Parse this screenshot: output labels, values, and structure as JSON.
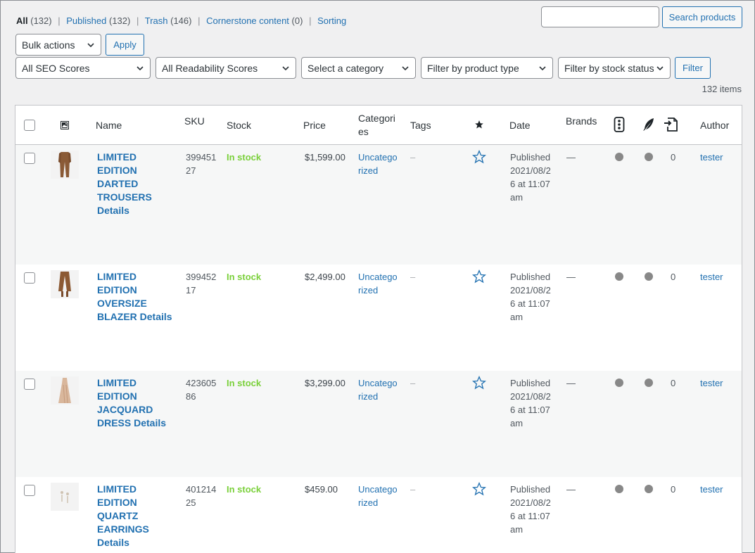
{
  "views": {
    "all": {
      "label": "All",
      "count": "(132)"
    },
    "published": {
      "label": "Published",
      "count": "(132)"
    },
    "trash": {
      "label": "Trash",
      "count": "(146)"
    },
    "cornerstone": {
      "label": "Cornerstone content",
      "count": "(0)"
    },
    "sorting": {
      "label": "Sorting"
    }
  },
  "search": {
    "placeholder": "",
    "button": "Search products"
  },
  "bulk": {
    "label": "Bulk actions",
    "apply": "Apply"
  },
  "filters": {
    "seo": "All SEO Scores",
    "readability": "All Readability Scores",
    "category": "Select a category",
    "product_type": "Filter by product type",
    "stock_status": "Filter by stock status",
    "button": "Filter"
  },
  "items_count": "132 items",
  "columns": {
    "name": "Name",
    "sku": "SKU",
    "stock": "Stock",
    "price": "Price",
    "categories": "Categories",
    "tags": "Tags",
    "date": "Date",
    "brands": "Brands",
    "author": "Author"
  },
  "rows": [
    {
      "name": "LIMITED EDITION DARTED TROUSERS Details",
      "sku": "39945127",
      "stock": "In stock",
      "price": "$1,599.00",
      "category": "Uncategorized",
      "tags": "–",
      "date": "Published 2021/08/26 at 11:07 am",
      "brand": "—",
      "links": "0",
      "author": "tester",
      "thumb_color": "#8a5a36"
    },
    {
      "name": "LIMITED EDITION OVERSIZE BLAZER Details",
      "sku": "39945217",
      "stock": "In stock",
      "price": "$2,499.00",
      "category": "Uncategorized",
      "tags": "–",
      "date": "Published 2021/08/26 at 11:07 am",
      "brand": "—",
      "links": "0",
      "author": "tester",
      "thumb_color": "#8c5a34"
    },
    {
      "name": "LIMITED EDITION JACQUARD DRESS Details",
      "sku": "42360586",
      "stock": "In stock",
      "price": "$3,299.00",
      "category": "Uncategorized",
      "tags": "–",
      "date": "Published 2021/08/26 at 11:07 am",
      "brand": "—",
      "links": "0",
      "author": "tester",
      "thumb_color": "#d9b79c"
    },
    {
      "name": "LIMITED EDITION QUARTZ EARRINGS Details",
      "sku": "40121425",
      "stock": "In stock",
      "price": "$459.00",
      "category": "Uncategorized",
      "tags": "–",
      "date": "Published 2021/08/26 at 11:07 am",
      "brand": "—",
      "links": "0",
      "author": "tester",
      "thumb_color": "#d8cfc2"
    }
  ],
  "icons": {
    "thumbnail_header": "image-icon",
    "featured_header": "star-filled-icon",
    "featured_cell": "star-outline-icon",
    "seo_header": "traffic-light-icon",
    "readability_header": "feather-icon",
    "links_header": "incoming-link-icon"
  }
}
